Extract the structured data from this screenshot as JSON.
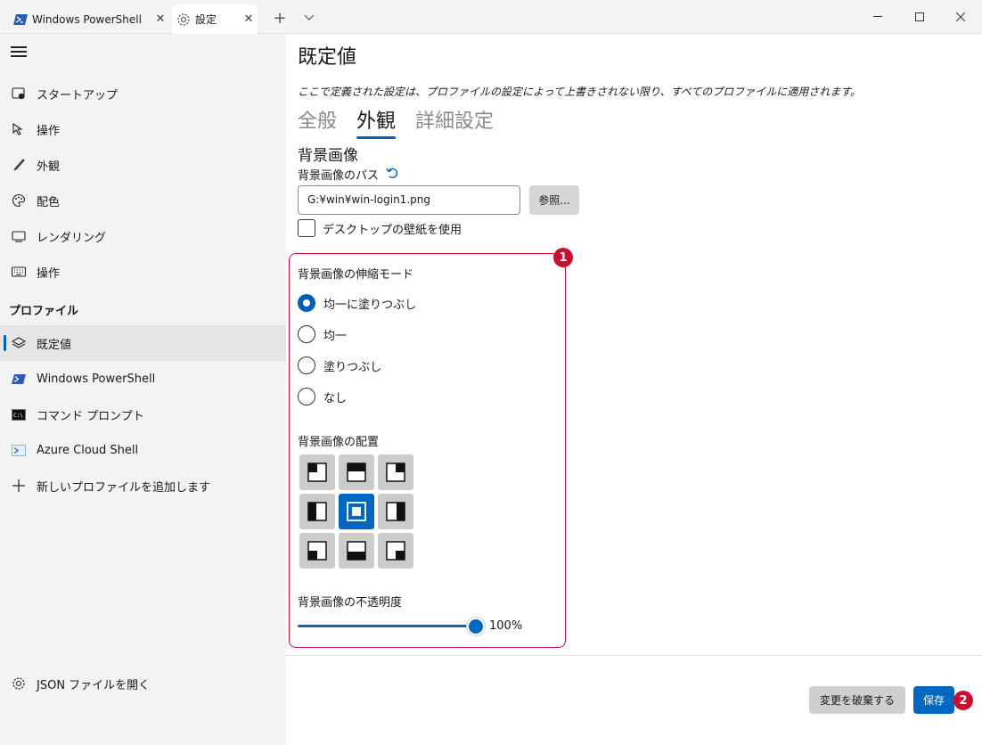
{
  "tabs": {
    "powershell_label": "Windows PowerShell",
    "settings_label": "設定",
    "close_glyph": "✕",
    "add_glyph": "+"
  },
  "sidebar": {
    "items": [
      {
        "label": "スタートアップ",
        "icon": "startup-icon"
      },
      {
        "label": "操作",
        "icon": "cursor-icon"
      },
      {
        "label": "外観",
        "icon": "brush-icon"
      },
      {
        "label": "配色",
        "icon": "palette-icon"
      },
      {
        "label": "レンダリング",
        "icon": "monitor-icon"
      },
      {
        "label": "操作",
        "icon": "keyboard-icon"
      }
    ],
    "section_label": "プロファイル",
    "profiles": [
      {
        "label": "既定値",
        "icon": "layers-icon",
        "active": true
      },
      {
        "label": "Windows PowerShell",
        "icon": "powershell-icon"
      },
      {
        "label": "コマンド プロンプト",
        "icon": "cmd-icon"
      },
      {
        "label": "Azure Cloud Shell",
        "icon": "azure-icon"
      },
      {
        "label": "新しいプロファイルを追加します",
        "icon": "plus-icon"
      }
    ],
    "json_label": "JSON ファイルを開く"
  },
  "main": {
    "title": "既定値",
    "description": "ここで定義された設定は、プロファイルの設定によって上書きされない限り、すべてのプロファイルに適用されます。",
    "subtabs": [
      "全般",
      "外観",
      "詳細設定"
    ],
    "active_subtab": 1,
    "section_title": "背景画像",
    "path_label": "背景画像のパス",
    "path_value": "G:¥win¥win-login1.png",
    "browse_label": "参照...",
    "desktop_wallpaper_label": "デスクトップの壁紙を使用",
    "stretch_label": "背景画像の伸縮モード",
    "stretch_options": [
      "均一に塗りつぶし",
      "均一",
      "塗りつぶし",
      "なし"
    ],
    "stretch_selected": 0,
    "alignment_label": "背景画像の配置",
    "alignment_selected": 4,
    "opacity_label": "背景画像の不透明度",
    "opacity_value": "100%",
    "opacity_fraction": 1.0,
    "discard_label": "変更を破棄する",
    "save_label": "保存",
    "badge1": "1",
    "badge2": "2"
  },
  "colors": {
    "accent": "#0067c0",
    "annotation": "#c8102e"
  }
}
